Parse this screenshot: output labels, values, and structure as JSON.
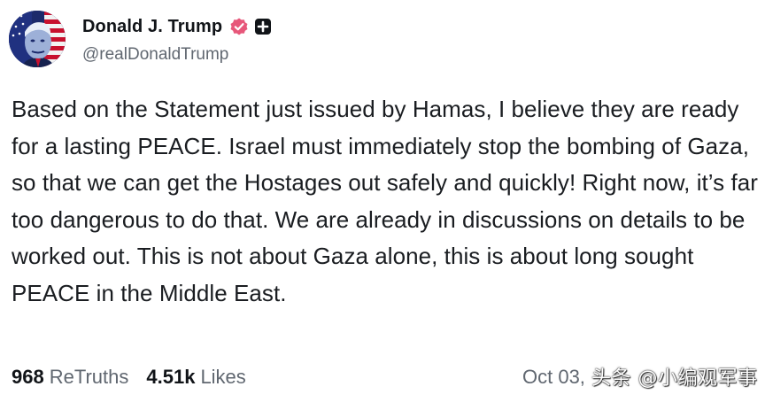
{
  "author": {
    "display_name": "Donald J. Trump",
    "handle": "@realDonaldTrump",
    "verified_icon": "verified-badge-icon",
    "extra_badge_icon": "plus-badge-icon",
    "verified_color": "#e7577a"
  },
  "post": {
    "text": "Based on the Statement just issued by Hamas, I believe they are ready for a lasting PEACE. Israel must immediately stop the bombing of Gaza, so that we can get the Hostages out safely and quickly! Right now, it’s far too dangerous to do that. We are already in discussions on details to be worked out. This is not about Gaza alone, this is about long sought PEACE in the Middle East."
  },
  "stats": {
    "retruths_count": "968",
    "retruths_label": "ReTruths",
    "likes_count": "4.51k",
    "likes_label": "Likes"
  },
  "timestamp": "Oct 03,",
  "watermark": "头条 @小编观军事"
}
